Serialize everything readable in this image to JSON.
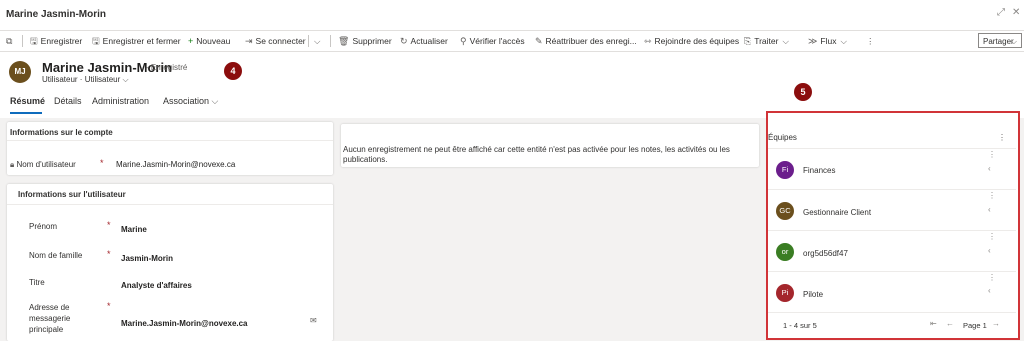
{
  "window": {
    "title": "Marine Jasmin-Morin"
  },
  "commands": [
    {
      "label": "Enregistrer",
      "icon": "save-icon"
    },
    {
      "label": "Enregistrer et fermer",
      "icon": "save-close-icon"
    },
    {
      "label": "Nouveau",
      "icon": "plus-icon"
    },
    {
      "label": "Se connecter",
      "icon": "sign-in-icon"
    },
    {
      "label": "Supprimer",
      "icon": "trash-icon"
    },
    {
      "label": "Actualiser",
      "icon": "refresh-icon"
    },
    {
      "label": "Vérifier l'accès",
      "icon": "check-access-icon"
    },
    {
      "label": "Réattribuer des enregi...",
      "icon": "reassign-icon"
    },
    {
      "label": "Rejoindre des équipes",
      "icon": "join-teams-icon"
    },
    {
      "label": "Traiter",
      "icon": "process-icon"
    },
    {
      "label": "Flux",
      "icon": "flow-icon"
    }
  ],
  "share_label": "Partager",
  "record": {
    "initials": "MJ",
    "name": "Marine Jasmin-Morin",
    "state": "- Enregistré",
    "entity": "Utilisateur",
    "form": "Utilisateur"
  },
  "callouts": {
    "header": "4",
    "teams": "5"
  },
  "tabs": [
    "Résumé",
    "Détails",
    "Administration",
    "Association"
  ],
  "account_section": {
    "title": "Informations sur le compte",
    "username_label": "Nom d'utilisateur",
    "username_value": "Marine.Jasmin-Morin@novexe.ca"
  },
  "user_section": {
    "title": "Informations sur l'utilisateur",
    "fields": [
      {
        "label": "Prénom",
        "value": "Marine"
      },
      {
        "label": "Nom de famille",
        "value": "Jasmin-Morin"
      },
      {
        "label": "Titre",
        "value": "Analyste d'affaires"
      },
      {
        "label": "Adresse de messagerie principale",
        "value": "Marine.Jasmin-Morin@novexe.ca"
      }
    ]
  },
  "timeline_message": "Aucun enregistrement ne peut être affiché car cette entité n'est pas activée pour les notes, les activités ou les publications.",
  "teams": {
    "title": "Équipes",
    "items": [
      {
        "initials": "Fi",
        "name": "Finances",
        "color": "#6b1e8c"
      },
      {
        "initials": "GC",
        "name": "Gestionnaire Client",
        "color": "#6b4f1d"
      },
      {
        "initials": "or",
        "name": "org5d56df47",
        "color": "#3a7d23"
      },
      {
        "initials": "Pi",
        "name": "Pilote",
        "color": "#a4262c"
      }
    ],
    "count": "1 - 4 sur 5",
    "page": "Page 1"
  }
}
